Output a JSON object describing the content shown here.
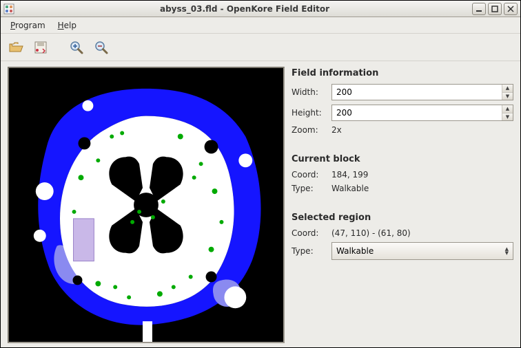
{
  "window": {
    "title": "abyss_03.fld - OpenKore Field Editor"
  },
  "menubar": {
    "program": "Program",
    "help": "Help"
  },
  "sections": {
    "field_info": "Field information",
    "current_block": "Current block",
    "selected_region": "Selected region"
  },
  "labels": {
    "width": "Width:",
    "height": "Height:",
    "zoom": "Zoom:",
    "coord": "Coord:",
    "type": "Type:"
  },
  "field": {
    "width": "200",
    "height": "200",
    "zoom": "2x"
  },
  "block": {
    "coord": "184, 199",
    "type": "Walkable"
  },
  "region": {
    "coord": "(47, 110) - (61, 80)",
    "type": "Walkable"
  }
}
